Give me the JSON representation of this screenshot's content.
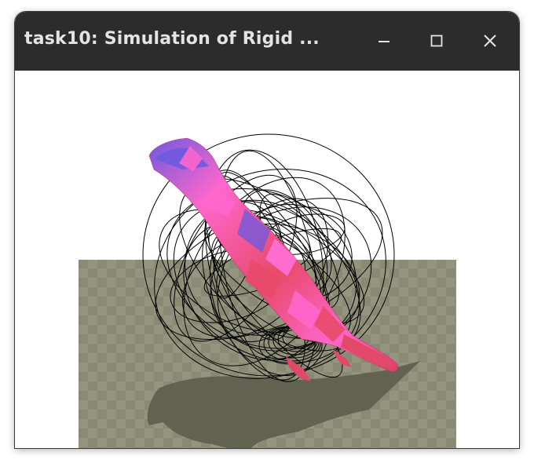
{
  "window": {
    "title": "task10: Simulation of Rigid ...",
    "controls": {
      "minimize_icon": "minimize-icon",
      "maximize_icon": "maximize-icon",
      "close_icon": "close-icon"
    }
  },
  "scene": {
    "background": "#ffffff",
    "floor_color_light": "#9a9a87",
    "floor_color_dark": "#8a8a74",
    "shadow_color": "#5a5a4a",
    "wire_sphere_color": "#000000",
    "body_colors": [
      "#ff66cc",
      "#e84a6a",
      "#6a5adf",
      "#d04070"
    ]
  }
}
